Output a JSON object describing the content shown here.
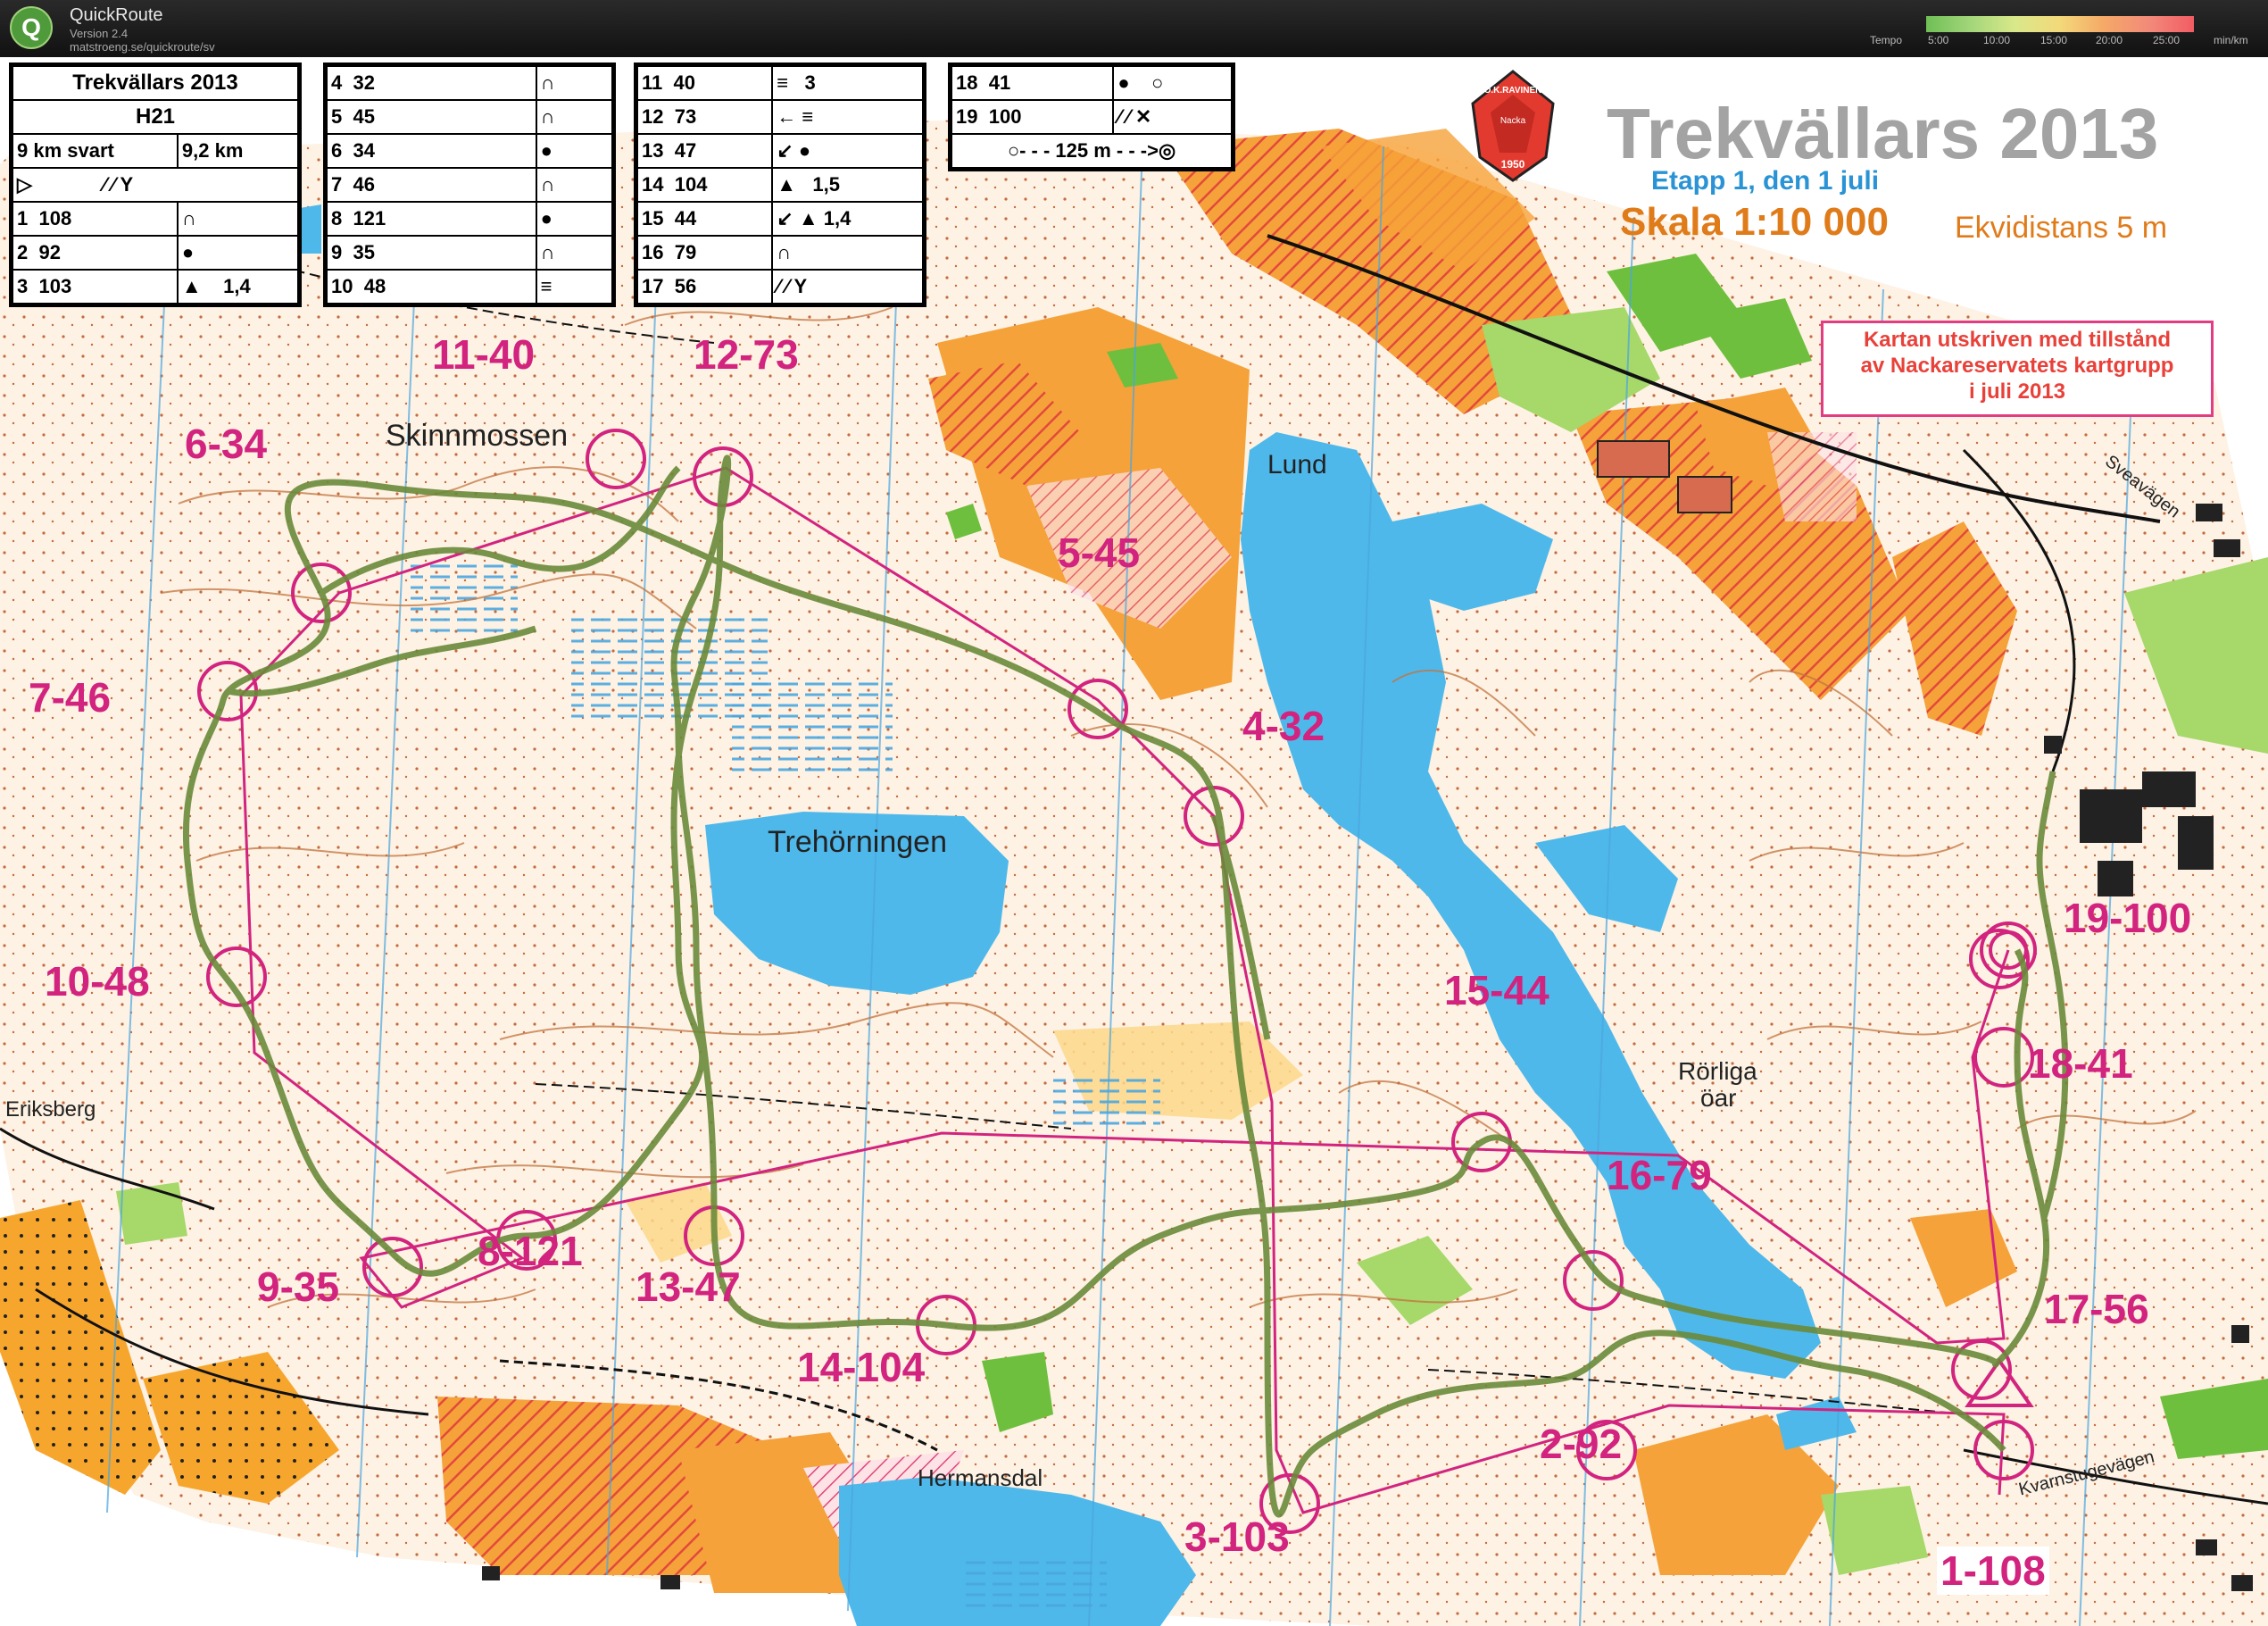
{
  "app": {
    "title": "QuickRoute",
    "version": "Version 2.4",
    "url": "matstroeng.se/quickroute/sv",
    "legend_label": "Tempo",
    "legend_ticks": [
      "5:00",
      "10:00",
      "15:00",
      "20:00",
      "25:00"
    ],
    "legend_unit": "min/km"
  },
  "map": {
    "title": "Trekvällars 2013",
    "stage": "Etapp 1, den 1 juli",
    "scale": "Skala 1:10 000",
    "contour": "Ekvidistans 5 m",
    "permission": [
      "Kartan utskriven med tillstånd",
      "av Nackareservatets kartgrupp",
      "i juli 2013"
    ],
    "club_logo_text": "O.K.RAVINEN",
    "club_logo_sub": "Nacka",
    "club_logo_year": "1950",
    "places": [
      "Skinnmossen",
      "Lund",
      "Trehörningen",
      "Rörliga",
      "öar",
      "Eriksberg",
      "Hermansdal",
      "Sveavägen",
      "Kvarnstugevägen"
    ],
    "control_labels": [
      "6-34",
      "11-40",
      "12-73",
      "5-45",
      "7-46",
      "4-32",
      "10-48",
      "19-100",
      "15-44",
      "18-41",
      "16-79",
      "8-121",
      "9-35",
      "13-47",
      "17-56",
      "14-104",
      "2-92",
      "3-103",
      "1-108"
    ]
  },
  "description": {
    "event": "Trekvällars 2013",
    "class": "H21",
    "course": "9 km svart",
    "length": "9,2 km",
    "table1": [
      {
        "n": "1",
        "code": "108"
      },
      {
        "n": "2",
        "code": "92"
      },
      {
        "n": "3",
        "code": "103",
        "dim": "1,4"
      }
    ],
    "table2": [
      {
        "n": "4",
        "code": "32"
      },
      {
        "n": "5",
        "code": "45"
      },
      {
        "n": "6",
        "code": "34"
      },
      {
        "n": "7",
        "code": "46"
      },
      {
        "n": "8",
        "code": "121"
      },
      {
        "n": "9",
        "code": "35"
      },
      {
        "n": "10",
        "code": "48"
      }
    ],
    "table3": [
      {
        "n": "11",
        "code": "40",
        "dim": "3"
      },
      {
        "n": "12",
        "code": "73"
      },
      {
        "n": "13",
        "code": "47"
      },
      {
        "n": "14",
        "code": "104",
        "dim": "1,5"
      },
      {
        "n": "15",
        "code": "44",
        "dim": "1,4"
      },
      {
        "n": "16",
        "code": "79"
      },
      {
        "n": "17",
        "code": "56"
      }
    ],
    "table4": [
      {
        "n": "18",
        "code": "41"
      },
      {
        "n": "19",
        "code": "100"
      }
    ],
    "finish": "125 m"
  }
}
